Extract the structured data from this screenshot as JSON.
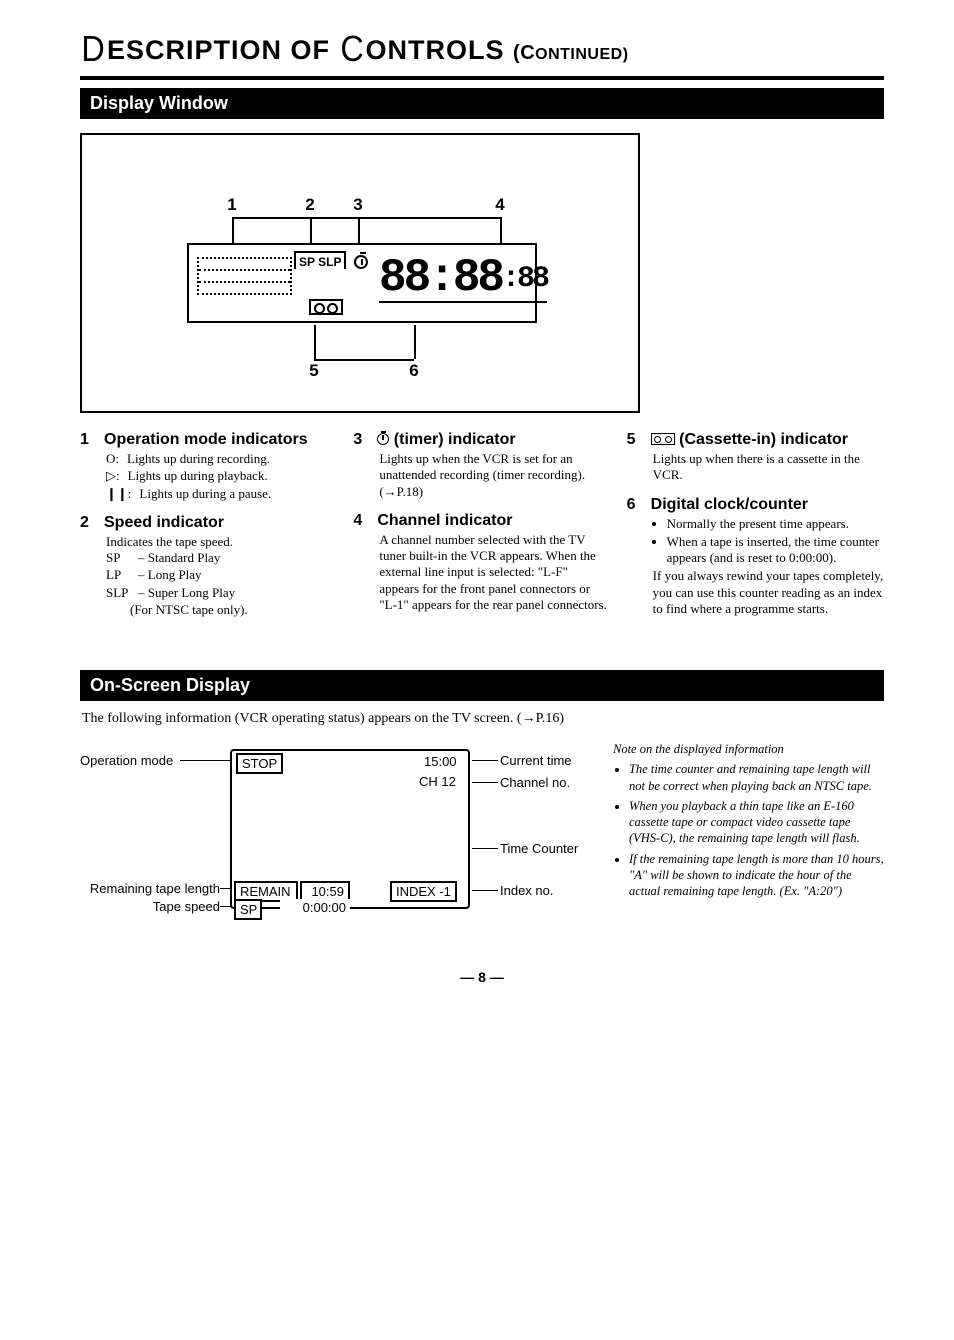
{
  "title": {
    "d_cap": "D",
    "part1": "ESCRIPTION OF ",
    "c_cap": "C",
    "part2": "ONTROLS ",
    "cont_open": "(C",
    "cont_rest": "ONTINUED)"
  },
  "section_display": "Display Window",
  "section_osd": "On-Screen Display",
  "diagram_callouts": {
    "n1": "1",
    "n2": "2",
    "n3": "3",
    "n4": "4",
    "n5": "5",
    "n6": "6"
  },
  "lcd": {
    "spslp": "SP SLP",
    "digits_main": "88:88",
    "digits_sub": ":88"
  },
  "items": [
    {
      "num": "1",
      "heading": "Operation mode indicators",
      "rows": [
        {
          "icon": "O:",
          "text": "Lights up during recording."
        },
        {
          "icon": "▷:",
          "text": "Lights up during playback."
        },
        {
          "icon": "❙❙:",
          "text": "Lights up during a pause."
        }
      ]
    },
    {
      "num": "2",
      "heading": "Speed indicator",
      "lead": "Indicates the tape speed.",
      "rows": [
        {
          "icon": "SP",
          "text": "– Standard Play"
        },
        {
          "icon": "LP",
          "text": "– Long Play"
        },
        {
          "icon": "SLP",
          "text": "– Super Long Play"
        }
      ],
      "tail": "(For NTSC tape only)."
    },
    {
      "num": "3",
      "heading_post": "(timer) indicator",
      "body": "Lights up when the VCR is set for an unattended recording (timer recording). (→P.18)"
    },
    {
      "num": "4",
      "heading": "Channel indicator",
      "body": "A channel number selected with the TV tuner built-in the VCR appears. When the external line input is selected: \"L-F\" appears for the front panel connectors or \"L-1\" appears for the rear panel connectors."
    },
    {
      "num": "5",
      "heading_post": "(Cassette-in) indicator",
      "body": "Lights up when there is a cassette in the VCR."
    },
    {
      "num": "6",
      "heading": "Digital clock/counter",
      "bullets": [
        "Normally the present time appears.",
        "When a tape is inserted, the time counter appears (and is reset to 0:00:00)."
      ],
      "tail_body": "If you always rewind your tapes completely, you can use this counter reading as an index to find where a programme starts."
    }
  ],
  "osd_intro": "The following information (VCR operating status) appears on the TV screen. (→P.16)",
  "osd": {
    "labels": {
      "op_mode": "Operation mode",
      "cur_time": "Current time",
      "ch_no": "Channel no.",
      "time_counter": "Time Counter",
      "remain": "Remaining tape length",
      "tape_speed": "Tape speed",
      "index_no": "Index no."
    },
    "tv": {
      "stop": "STOP",
      "time": "15:00",
      "ch": "CH 12",
      "remain_label": "REMAIN",
      "remain_val": "10:59",
      "sp": "SP",
      "counter": "0:00:00",
      "index": "INDEX -1"
    }
  },
  "osd_note": {
    "heading": "Note on the displayed information",
    "items": [
      "The time counter and remaining tape length will not be correct when playing back an NTSC tape.",
      "When you playback a thin tape like an E-160 cassette tape or compact video cassette tape (VHS-C), the remaining tape length will flash.",
      "If the remaining tape length is more than 10 hours, \"A\" will be shown to indicate the hour of the actual remaining tape length. (Ex. \"A:20\")"
    ]
  },
  "page_number": "— 8 —"
}
